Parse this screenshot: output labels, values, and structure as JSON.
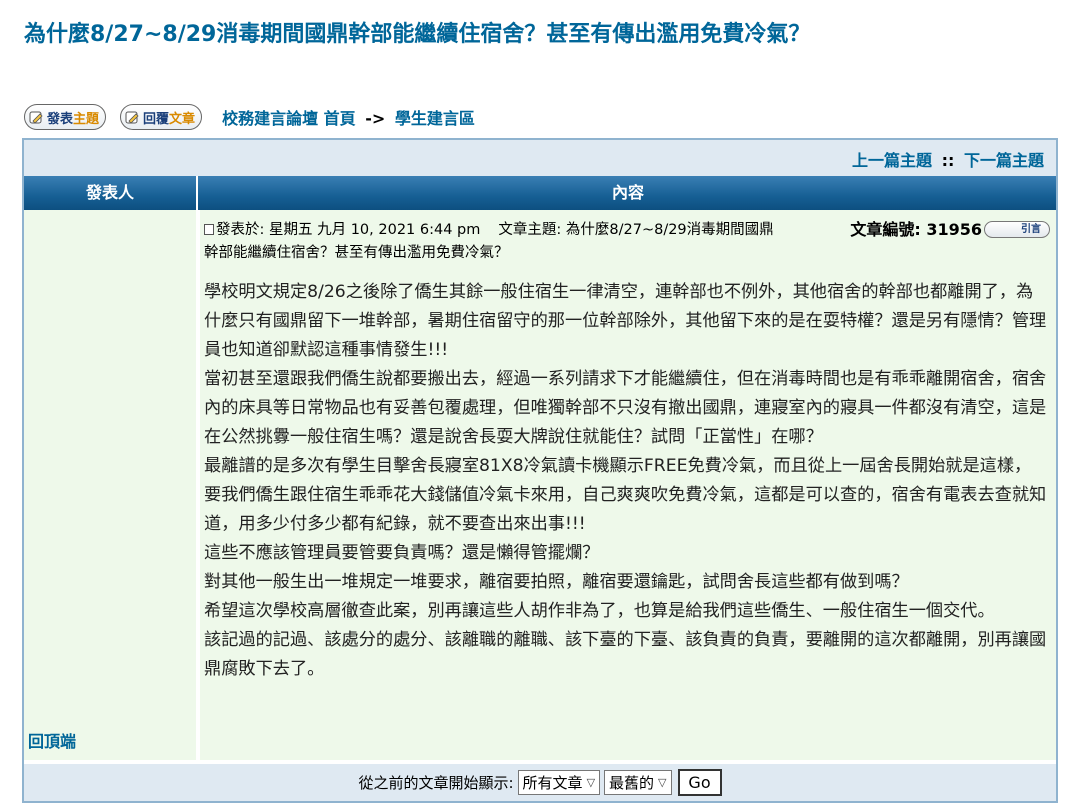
{
  "topic": {
    "title": "為什麼8/27~8/29消毒期間國鼎幹部能繼續住宿舍？甚至有傳出濫用免費冷氣？"
  },
  "toolbar": {
    "new_topic_a": "發表",
    "new_topic_b": "主題",
    "reply_a": "回覆",
    "reply_b": "文章",
    "forum_index": "校務建言論壇 首頁",
    "arrow": "->",
    "forum_name": "學生建言區"
  },
  "nav": {
    "prev": "上一篇主題",
    "sep": "::",
    "next": "下一篇主題"
  },
  "table": {
    "author_header": "發表人",
    "content_header": "內容",
    "back_to_top": "回頂端"
  },
  "post": {
    "posted_label": "發表於: 星期五 九月 10, 2021 6:44 pm",
    "subject_label": "文章主題: 為什麼8/27~8/29消毒期間國鼎",
    "subject_cont": "幹部能繼續住宿舍？甚至有傳出濫用免費冷氣？",
    "post_no": "文章編號: 31956",
    "quote": "引言",
    "body": [
      "學校明文規定8/26之後除了僑生其餘一般住宿生一律清空，連幹部也不例外，其他宿舍的幹部也都離開了，為什麼只有國鼎留下一堆幹部，暑期住宿留守的那一位幹部除外，其他留下來的是在耍特權？還是另有隱情？管理員也知道卻默認這種事情發生!!!",
      "當初甚至還跟我們僑生說都要搬出去，經過一系列請求下才能繼續住，但在消毒時間也是有乖乖離開宿舍，宿舍內的床具等日常物品也有妥善包覆處理，但唯獨幹部不只沒有撤出國鼎，連寢室內的寢具一件都沒有清空，這是在公然挑釁一般住宿生嗎？還是說舍長耍大牌說住就能住？試問「正當性」在哪？",
      "最離譜的是多次有學生目擊舍長寢室81X8冷氣讀卡機顯示FREE免費冷氣，而且從上一屆舍長開始就是這樣，要我們僑生跟住宿生乖乖花大錢儲值冷氣卡來用，自己爽爽吹免費冷氣，這都是可以查的，宿舍有電表去查就知道，用多少付多少都有紀錄，就不要查出來出事!!!",
      "這些不應該管理員要管要負責嗎？還是懶得管擺爛？",
      "對其他一般生出一堆規定一堆要求，離宿要拍照，離宿要還鑰匙，試問舍長這些都有做到嗎？",
      "希望這次學校高層徹查此案，別再讓這些人胡作非為了，也算是給我們這些僑生、一般住宿生一個交代。",
      "該記過的記過、該處分的處分、該離職的離職、該下臺的下臺、該負責的負責，要離開的這次都離開，別再讓國鼎腐敗下去了。"
    ]
  },
  "footer": {
    "label": "從之前的文章開始顯示:",
    "range_value": "所有文章",
    "order_value": "最舊的",
    "go": "Go"
  }
}
